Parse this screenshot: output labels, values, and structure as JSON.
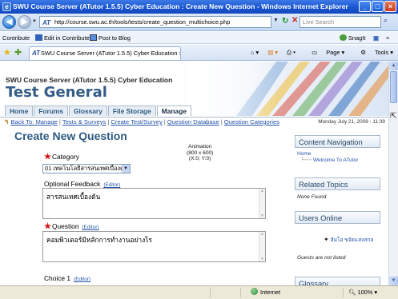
{
  "window": {
    "title": "SWU Course Server (ATutor 1.5.5) Cyber Education : Create New Question - Windows Internet Explorer",
    "app_icon": "e",
    "minimize": "_",
    "maximize": "□",
    "close": "×"
  },
  "address_bar": {
    "url": "http://course.swu.ac.th/tools/tests/create_question_multichoice.php",
    "favicon": "AT",
    "search_placeholder": "Live Search"
  },
  "links_bar": {
    "contribute": "Contribute",
    "edit_in_contribute": "Edit in Contribute",
    "post_to_blog": "Post to Blog",
    "snagit": "SnagIt"
  },
  "tab_bar": {
    "tab_title": "SWU Course Server (ATutor 1.5.5) Cyber Education :...",
    "page_menu": "Page ▾",
    "tools_menu": "Tools ▾"
  },
  "site": {
    "course_name": "SWU Course Server (ATutor 1.5.5) Cyber Education",
    "course_title": "Test General",
    "nav_tabs": [
      "Home",
      "Forums",
      "Glossary",
      "File Storage",
      "Manage"
    ],
    "active_tab": "Manage"
  },
  "breadcrumb": {
    "items": [
      "Back To: Manage",
      "Tests & Surveys",
      "Create Test/Survey",
      "Question Database",
      "Question Categories"
    ],
    "separator": "|",
    "date": "Monday July 21, 2008 - 11:39"
  },
  "main": {
    "page_title": "Create New Question",
    "animation_note": [
      "Animation",
      "(800 x 600)",
      "(X:0; Y:0)"
    ],
    "category_label": "Category",
    "category_value": "01 เทคโนโลยีสารสนเทศเบื้องต้น",
    "optional_feedback_label": "Optional Feedback",
    "editor_link": "(Editor)",
    "optional_feedback_value": "สารสนเทศเบื้องต้น",
    "question_label": "Question",
    "question_value": "คอมพิวเตอร์มีหลักการทำงานอย่างไร",
    "choice1_label": "Choice 1",
    "required_marker": "★"
  },
  "sidebar": {
    "content_navigation": {
      "heading": "Content Navigation",
      "home": "Home",
      "welcome": "Welcome To ATutor"
    },
    "related_topics": {
      "heading": "Related Topics",
      "body": "None Found."
    },
    "users_online": {
      "heading": "Users Online",
      "user": "ส้มโอ ขจัดแสงสกล",
      "guests": "Guests are not listed"
    },
    "glossary": {
      "heading": "Glossary"
    }
  },
  "status_bar": {
    "zone": "Internet",
    "zoom": "100%"
  },
  "colors": {
    "titlebar": "#1a55d0",
    "site_title": "#335c86",
    "link": "#2553a8",
    "required": "#d41414"
  },
  "icons": [
    "back-arrow-icon",
    "forward-arrow-icon",
    "refresh-icon",
    "stop-icon",
    "search-icon",
    "favorites-star-icon",
    "add-favorites-icon",
    "home-icon",
    "feeds-icon",
    "print-icon",
    "page-icon",
    "tools-icon",
    "globe-icon",
    "zoom-icon",
    "user-icon"
  ]
}
